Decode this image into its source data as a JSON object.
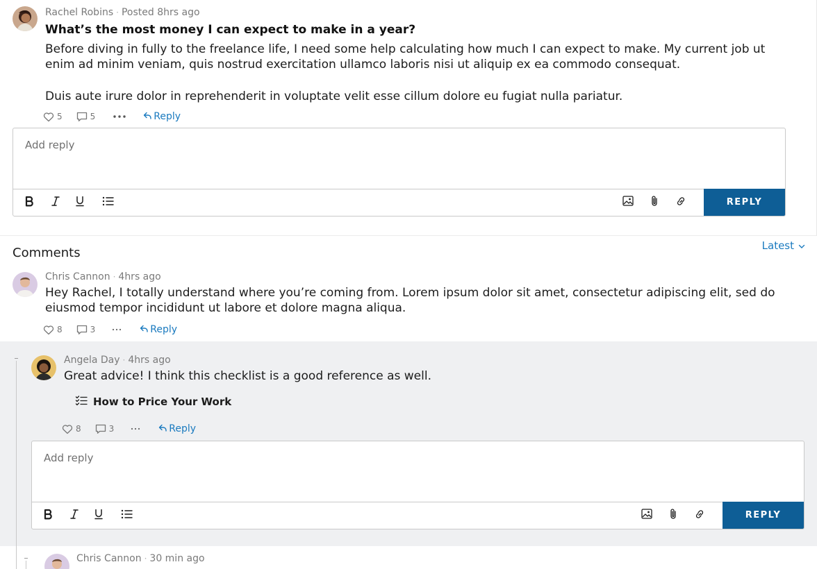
{
  "post": {
    "author": "Rachel Robins",
    "time": "Posted 8hrs ago",
    "title": "What’s the most money I can expect to make in a year?",
    "paragraph1": "Before diving in fully to the freelance life, I need some help calculating how much I can expect to make. My current job ut enim ad minim veniam, quis nostrud exercitation ullamco laboris nisi ut aliquip ex ea commodo consequat.",
    "paragraph2": "Duis aute irure dolor in reprehenderit in voluptate velit esse cillum dolore eu fugiat nulla pariatur.",
    "likes": "5",
    "comments": "5",
    "reply_label": "Reply"
  },
  "editor": {
    "placeholder": "Add reply",
    "reply_button": "REPLY"
  },
  "comments": {
    "heading": "Comments",
    "sort_label": "Latest",
    "items": [
      {
        "author": "Chris Cannon",
        "time": "4hrs ago",
        "text": "Hey Rachel, I totally understand where you’re coming from. Lorem ipsum dolor sit amet, consectetur adipiscing elit, sed do eiusmod tempor incididunt ut labore et dolore magna aliqua.",
        "likes": "8",
        "replies": "3",
        "reply_label": "Reply"
      },
      {
        "author": "Angela Day",
        "time": "4hrs ago",
        "text": "Great advice! I think this checklist is a good reference as well.",
        "attachment": "How to Price Your Work",
        "likes": "8",
        "replies": "3",
        "reply_label": "Reply"
      },
      {
        "author": "Chris Cannon",
        "time": "30 min ago"
      }
    ]
  },
  "colors": {
    "accent": "#1a7abf",
    "button": "#0e5e96",
    "nested_bg": "#eff0f2"
  },
  "icons": [
    "heart-icon",
    "comment-icon",
    "more-icon",
    "reply-icon",
    "bold-icon",
    "italic-icon",
    "underline-icon",
    "list-icon",
    "image-icon",
    "attachment-icon",
    "link-icon",
    "checklist-icon",
    "chevron-down-icon"
  ]
}
